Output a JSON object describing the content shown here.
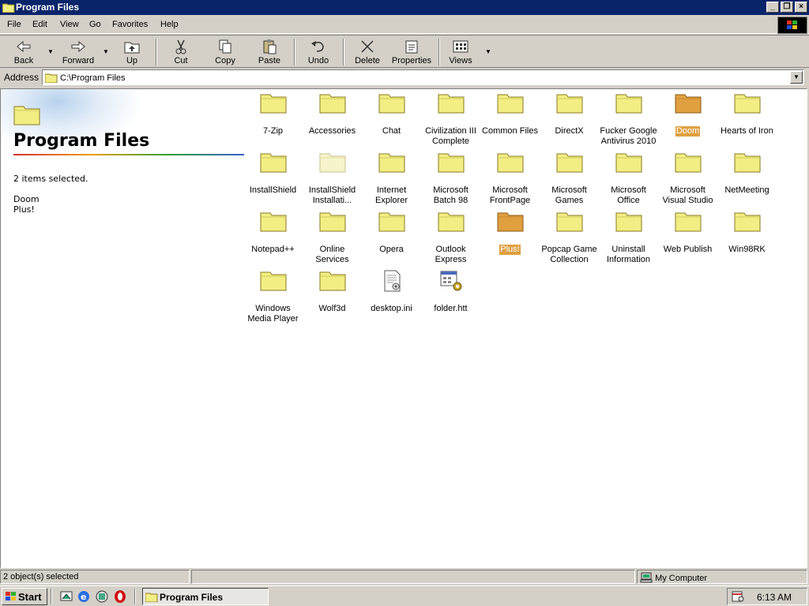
{
  "window": {
    "title": "Program Files"
  },
  "menu": [
    "File",
    "Edit",
    "View",
    "Go",
    "Favorites",
    "Help"
  ],
  "toolbar": {
    "back": "Back",
    "forward": "Forward",
    "up": "Up",
    "cut": "Cut",
    "copy": "Copy",
    "paste": "Paste",
    "undo": "Undo",
    "delete": "Delete",
    "properties": "Properties",
    "views": "Views"
  },
  "address": {
    "label": "Address",
    "value": "C:\\Program Files"
  },
  "left_pane": {
    "title": "Program Files",
    "info": "2 items selected.",
    "selected": [
      "Doom",
      "Plus!"
    ]
  },
  "items": [
    {
      "name": "7-Zip",
      "type": "folder"
    },
    {
      "name": "Accessories",
      "type": "folder"
    },
    {
      "name": "Chat",
      "type": "folder"
    },
    {
      "name": "Civilization III Complete",
      "type": "folder"
    },
    {
      "name": "Common Files",
      "type": "folder"
    },
    {
      "name": "DirectX",
      "type": "folder"
    },
    {
      "name": "Fucker Google Antivirus 2010",
      "type": "folder"
    },
    {
      "name": "Doom",
      "type": "folder",
      "selected": true
    },
    {
      "name": "Hearts of Iron",
      "type": "folder"
    },
    {
      "name": "InstallShield",
      "type": "folder"
    },
    {
      "name": "InstallShield Installati...",
      "type": "folder",
      "faded": true
    },
    {
      "name": "Internet Explorer",
      "type": "folder"
    },
    {
      "name": "Microsoft Batch 98",
      "type": "folder"
    },
    {
      "name": "Microsoft FrontPage",
      "type": "folder"
    },
    {
      "name": "Microsoft Games",
      "type": "folder"
    },
    {
      "name": "Microsoft Office",
      "type": "folder"
    },
    {
      "name": "Microsoft Visual Studio",
      "type": "folder"
    },
    {
      "name": "NetMeeting",
      "type": "folder"
    },
    {
      "name": "Notepad++",
      "type": "folder"
    },
    {
      "name": "Online Services",
      "type": "folder"
    },
    {
      "name": "Opera",
      "type": "folder"
    },
    {
      "name": "Outlook Express",
      "type": "folder"
    },
    {
      "name": "Plus!",
      "type": "folder",
      "selected": true
    },
    {
      "name": "Popcap Game Collection",
      "type": "folder"
    },
    {
      "name": "Uninstall Information",
      "type": "folder"
    },
    {
      "name": "Web Publish",
      "type": "folder"
    },
    {
      "name": "Win98RK",
      "type": "folder"
    },
    {
      "name": "Windows Media Player",
      "type": "folder"
    },
    {
      "name": "Wolf3d",
      "type": "folder"
    },
    {
      "name": "desktop.ini",
      "type": "ini"
    },
    {
      "name": "folder.htt",
      "type": "htt"
    }
  ],
  "status": {
    "objects": "2 object(s) selected",
    "middle": "",
    "zone": "My Computer"
  },
  "taskbar": {
    "start": "Start",
    "task": "Program Files",
    "clock": "6:13 AM"
  },
  "colors": {
    "titlebar": "#0a246a",
    "folder": "#f2ee84",
    "folder_selected": "#e0a040",
    "face": "#d4d0c8"
  }
}
